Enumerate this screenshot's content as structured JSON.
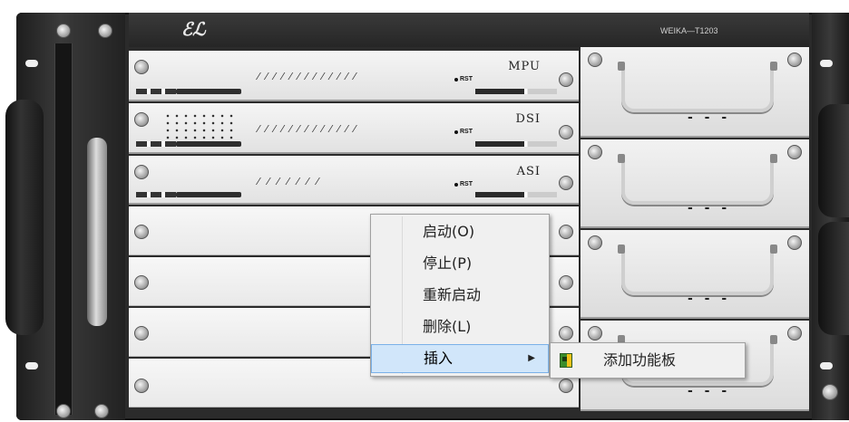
{
  "device": {
    "logo_text": "ℰℒ",
    "model": "WEIKA—T1203"
  },
  "cards": [
    {
      "label": "MPU",
      "rst": "RST"
    },
    {
      "label": "DSI",
      "rst": "RST"
    },
    {
      "label": "ASI",
      "rst": "RST"
    }
  ],
  "context_menu": {
    "items": [
      {
        "label": "启动(O)"
      },
      {
        "label": "停止(P)"
      },
      {
        "label": "重新启动"
      },
      {
        "label": "删除(L)"
      },
      {
        "label": "插入",
        "has_submenu": true
      }
    ],
    "submenu_arrow": "▶",
    "submenu": {
      "items": [
        {
          "label": "添加功能板",
          "icon": "board-icon"
        }
      ]
    }
  },
  "colors": {
    "menu_highlight": "#d1e6fa",
    "menu_highlight_border": "#7ab1e8",
    "chassis": "#2b2b2b"
  }
}
